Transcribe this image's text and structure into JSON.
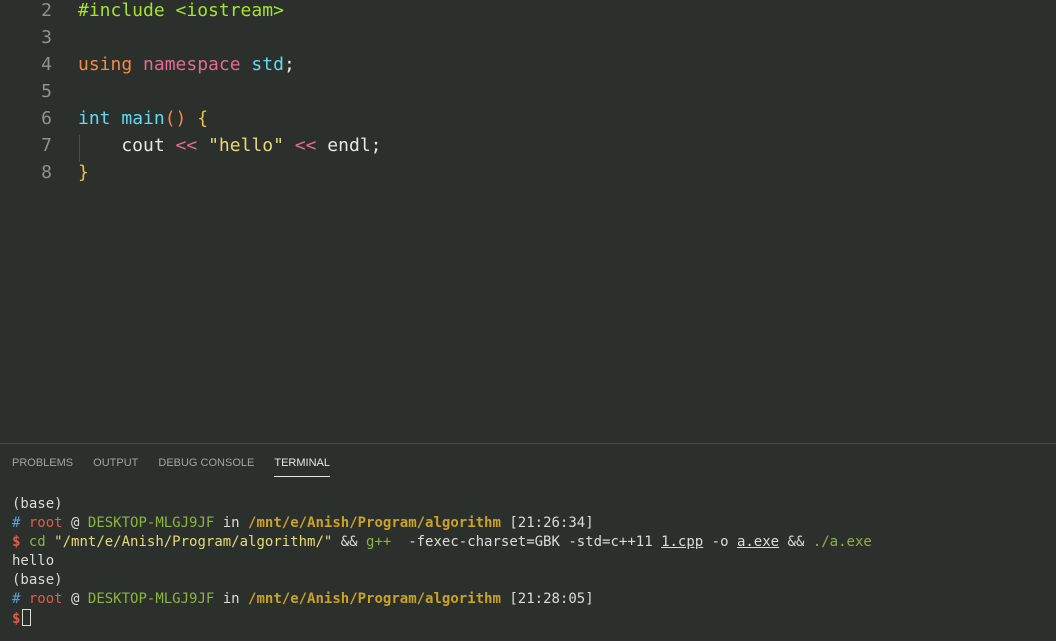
{
  "editor": {
    "lines": [
      {
        "num": "2",
        "tokens": [
          {
            "t": "#include <iostream>",
            "c": "tok-pre"
          }
        ]
      },
      {
        "num": "3",
        "tokens": []
      },
      {
        "num": "4",
        "tokens": [
          {
            "t": "using",
            "c": "tok-kw"
          },
          {
            "t": " ",
            "c": ""
          },
          {
            "t": "namespace",
            "c": "tok-ns"
          },
          {
            "t": " ",
            "c": ""
          },
          {
            "t": "std",
            "c": "tok-type"
          },
          {
            "t": ";",
            "c": ""
          }
        ]
      },
      {
        "num": "5",
        "tokens": []
      },
      {
        "num": "6",
        "tokens": [
          {
            "t": "int",
            "c": "tok-type"
          },
          {
            "t": " ",
            "c": ""
          },
          {
            "t": "main",
            "c": "tok-type"
          },
          {
            "t": "()",
            "c": "tok-paren"
          },
          {
            "t": " ",
            "c": ""
          },
          {
            "t": "{",
            "c": "tok-brace"
          }
        ]
      },
      {
        "num": "7",
        "tokens": [
          {
            "t": "    cout ",
            "c": ""
          },
          {
            "t": "<<",
            "c": "tok-op"
          },
          {
            "t": " ",
            "c": ""
          },
          {
            "t": "\"hello\"",
            "c": "tok-str"
          },
          {
            "t": " ",
            "c": ""
          },
          {
            "t": "<<",
            "c": "tok-op"
          },
          {
            "t": " endl;",
            "c": ""
          }
        ]
      },
      {
        "num": "8",
        "tokens": [
          {
            "t": "}",
            "c": "tok-brace"
          }
        ]
      }
    ]
  },
  "panel": {
    "tabs": [
      "PROBLEMS",
      "OUTPUT",
      "DEBUG CONSOLE",
      "TERMINAL"
    ],
    "active_tab": "TERMINAL"
  },
  "terminal": {
    "lines": [
      [
        {
          "t": "(base)",
          "c": "t-plain"
        }
      ],
      [
        {
          "t": "#",
          "c": "t-hash"
        },
        {
          "t": " ",
          "c": ""
        },
        {
          "t": "root",
          "c": "t-root"
        },
        {
          "t": " @ ",
          "c": "t-at"
        },
        {
          "t": "DESKTOP-MLGJ9JF",
          "c": "t-host"
        },
        {
          "t": " in ",
          "c": "t-in"
        },
        {
          "t": "/mnt/e/Anish/Program/algorithm",
          "c": "t-path"
        },
        {
          "t": " [21:26:34]",
          "c": "t-time"
        }
      ],
      [
        {
          "t": "$",
          "c": "t-dollar"
        },
        {
          "t": " ",
          "c": ""
        },
        {
          "t": "cd",
          "c": "t-cmd"
        },
        {
          "t": " ",
          "c": ""
        },
        {
          "t": "\"/mnt/e/Anish/Program/algorithm/\"",
          "c": "t-str"
        },
        {
          "t": " && ",
          "c": "t-plain"
        },
        {
          "t": "g++",
          "c": "t-cmd"
        },
        {
          "t": "  -fexec-charset=GBK -std=c++11 ",
          "c": "t-plain"
        },
        {
          "t": "1.cpp",
          "c": "t-plain t-ul"
        },
        {
          "t": " -o ",
          "c": "t-plain"
        },
        {
          "t": "a.exe",
          "c": "t-plain t-ul"
        },
        {
          "t": " && ",
          "c": "t-plain"
        },
        {
          "t": "./a.exe",
          "c": "t-green"
        }
      ],
      [
        {
          "t": "hello",
          "c": "t-plain"
        }
      ],
      [
        {
          "t": "(base)",
          "c": "t-plain"
        }
      ],
      [
        {
          "t": "#",
          "c": "t-hash"
        },
        {
          "t": " ",
          "c": ""
        },
        {
          "t": "root",
          "c": "t-root"
        },
        {
          "t": " @ ",
          "c": "t-at"
        },
        {
          "t": "DESKTOP-MLGJ9JF",
          "c": "t-host"
        },
        {
          "t": " in ",
          "c": "t-in"
        },
        {
          "t": "/mnt/e/Anish/Program/algorithm",
          "c": "t-path"
        },
        {
          "t": " [21:28:05]",
          "c": "t-time"
        }
      ],
      [
        {
          "t": "$",
          "c": "t-dollar"
        }
      ]
    ]
  },
  "colors": {
    "background": "#2b302d",
    "keyword": "#f48a43",
    "type": "#66d9ef",
    "string": "#e6db74",
    "preprocessor": "#a6e22e",
    "prompt_root": "#e05a4f",
    "prompt_host": "#8fb33e",
    "prompt_path": "#c9a227"
  }
}
